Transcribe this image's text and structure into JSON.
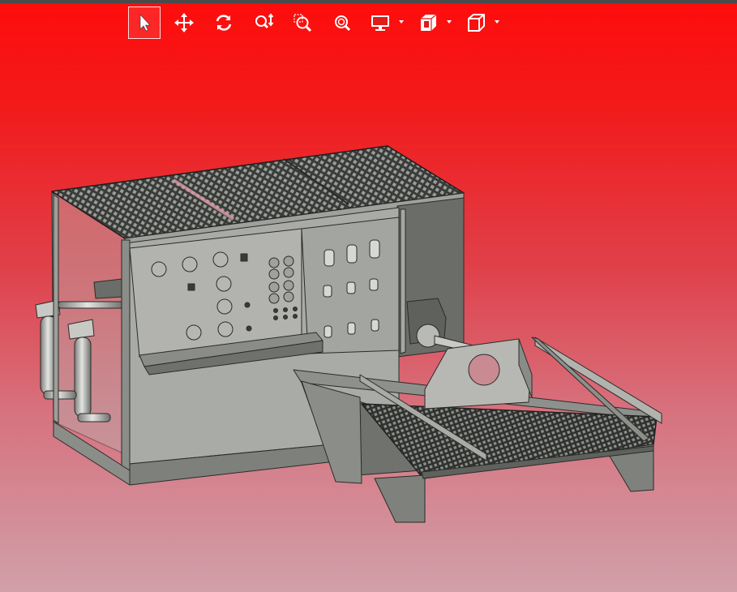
{
  "toolbar": {
    "tools": [
      {
        "name": "select",
        "icon": "arrow-cursor-icon",
        "active": true
      },
      {
        "name": "pan",
        "icon": "move-arrows-icon",
        "active": false
      },
      {
        "name": "rotate",
        "icon": "rotate-icon",
        "active": false
      },
      {
        "name": "zoom",
        "icon": "zoom-updown-icon",
        "active": false
      },
      {
        "name": "zoom-window",
        "icon": "zoom-window-icon",
        "active": false
      },
      {
        "name": "zoom-fit",
        "icon": "zoom-fit-icon",
        "active": false
      },
      {
        "name": "display-mode",
        "icon": "monitor-icon",
        "dropdown": true
      },
      {
        "name": "section",
        "icon": "section-cube-icon",
        "dropdown": true
      },
      {
        "name": "view-orientation",
        "icon": "cube-view-icon",
        "dropdown": true
      }
    ]
  },
  "colors": {
    "background_top": "#ff0c0c",
    "background_bottom": "#d1a0a9",
    "model_gray": "#a9aba6",
    "model_dark": "#6f716d",
    "icon": "#ffffff"
  }
}
